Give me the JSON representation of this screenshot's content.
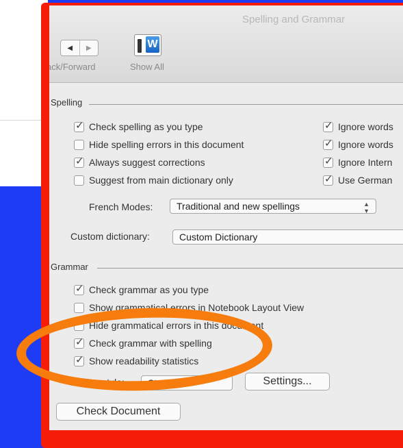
{
  "window": {
    "title": "Spelling and Grammar",
    "nav_label": "ack/Forward",
    "back_glyph": "◀",
    "forward_glyph": "▶",
    "show_all_label": "Show All",
    "show_all_glyph": "W"
  },
  "spelling": {
    "header": "Spelling",
    "left_options": [
      {
        "label": "Check spelling as you type",
        "checked": true
      },
      {
        "label": "Hide spelling errors in this document",
        "checked": false
      },
      {
        "label": "Always suggest corrections",
        "checked": true
      },
      {
        "label": "Suggest from main dictionary only",
        "checked": false
      }
    ],
    "right_options": [
      {
        "label": "Ignore words",
        "checked": true
      },
      {
        "label": "Ignore words",
        "checked": true
      },
      {
        "label": "Ignore Intern",
        "checked": true
      },
      {
        "label": "Use German",
        "checked": true
      }
    ],
    "french_modes_label": "French Modes:",
    "french_modes_value": "Traditional and new spellings",
    "custom_dictionary_label": "Custom dictionary:",
    "custom_dictionary_value": "Custom Dictionary"
  },
  "grammar": {
    "header": "Grammar",
    "options": [
      {
        "label": "Check grammar as you type",
        "checked": true
      },
      {
        "label": "Show grammatical errors in Notebook Layout View",
        "checked": false
      },
      {
        "label": "Hide grammatical errors in this document",
        "checked": false
      },
      {
        "label": "Check grammar with spelling",
        "checked": true
      },
      {
        "label": "Show readability statistics",
        "checked": true
      }
    ],
    "writing_style_label": "Writing style:",
    "writing_style_value": "Standard",
    "settings_button": "Settings...",
    "check_document_button": "Check Document"
  },
  "colors": {
    "background": "#1f3cf5",
    "frame_highlight": "#f51d07",
    "circle_annotation": "#f57c0d"
  }
}
